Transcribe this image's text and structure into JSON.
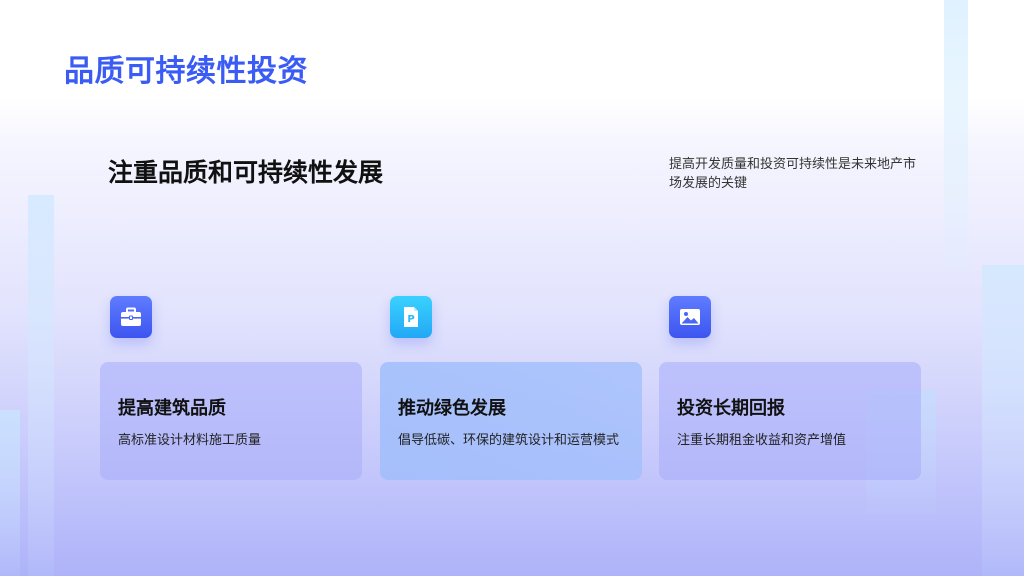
{
  "page": {
    "title": "品质可持续性投资"
  },
  "section": {
    "heading": "注重品质和可持续性发展",
    "description": "提高开发质量和投资可持续性是未来地产市场发展的关键"
  },
  "cards": [
    {
      "icon": "briefcase-icon",
      "title": "提高建筑品质",
      "description": "高标准设计材料施工质量"
    },
    {
      "icon": "document-p-icon",
      "title": "推动绿色发展",
      "description": "倡导低碳、环保的建筑设计和运营模式"
    },
    {
      "icon": "image-icon",
      "title": "投资长期回报",
      "description": "注重长期租金收益和资产增值"
    }
  ],
  "icon_glyphs": {
    "document_letter": "P"
  },
  "colors": {
    "title_accent": "#3a5cf5",
    "icon_blue": "#4a66f5",
    "icon_cyan": "#2bb8f8"
  }
}
